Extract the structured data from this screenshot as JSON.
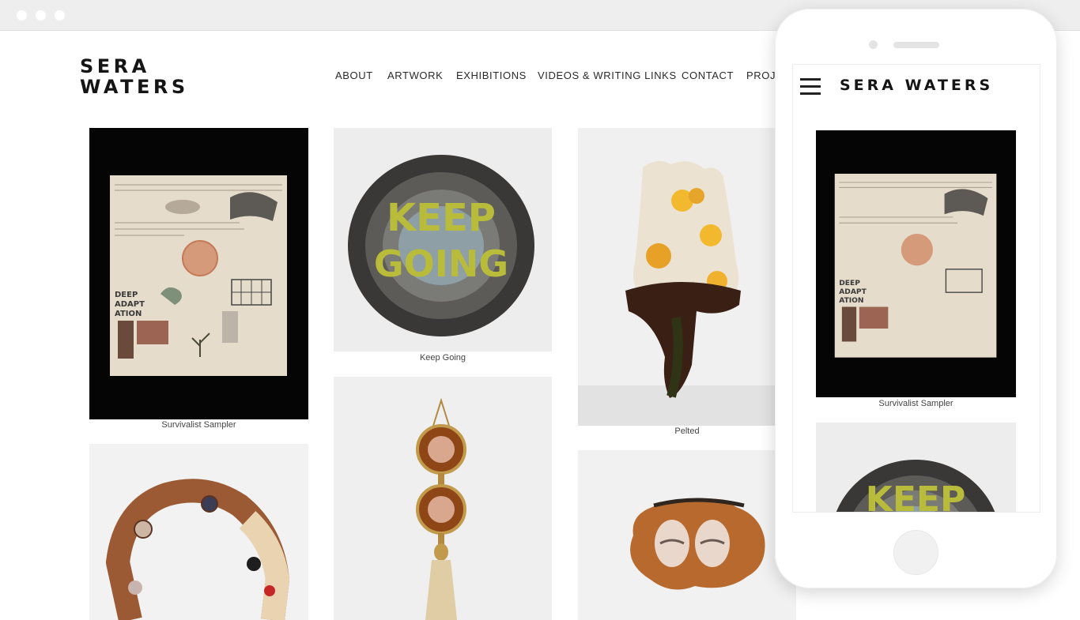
{
  "browser": {
    "controls": [
      "dot",
      "dot",
      "dot"
    ]
  },
  "site": {
    "logo_line1": "SERA",
    "logo_line2": "WATERS",
    "nav": [
      "ABOUT",
      "ARTWORK",
      "EXHIBITIONS",
      "VIDEOS & WRITING LINKS",
      "CONTACT",
      "PROJECTS"
    ]
  },
  "gallery": {
    "captions": {
      "survivalist": "Survivalist Sampler",
      "keep_going": "Keep Going",
      "pelted": "Pelted"
    },
    "artwork_text": {
      "keep": "KEEP",
      "going": "GOING"
    }
  },
  "mobile": {
    "logo": "SERA WATERS",
    "menu_icon": "hamburger-icon",
    "caption": "Survivalist Sampler",
    "partial_text": "KEEP"
  }
}
